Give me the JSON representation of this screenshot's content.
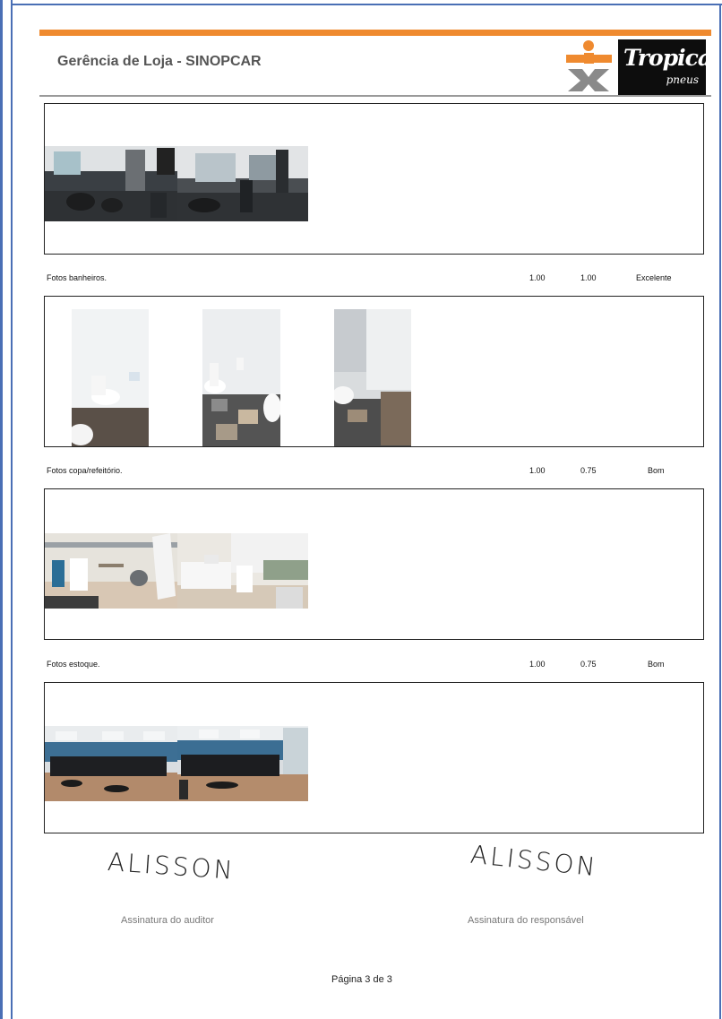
{
  "header": {
    "title": "Gerência de Loja - SINOPCAR",
    "brand_name": "Tropical",
    "brand_sub": "pneus",
    "brand_color": "#ef8a2f"
  },
  "sections": [
    {
      "label": "Fotos banheiros.",
      "value1": "1.00",
      "value2": "1.00",
      "rating": "Excelente"
    },
    {
      "label": "Fotos copa/refeitório.",
      "value1": "1.00",
      "value2": "0.75",
      "rating": "Bom"
    },
    {
      "label": "Fotos estoque.",
      "value1": "1.00",
      "value2": "0.75",
      "rating": "Bom"
    }
  ],
  "signatures": {
    "auditor_signature": "ALISSON",
    "auditor_caption": "Assinatura do auditor",
    "responsible_signature": "ALISSON",
    "responsible_caption": "Assinatura do responsável"
  },
  "footer": {
    "page": "Página 3 de 3"
  }
}
